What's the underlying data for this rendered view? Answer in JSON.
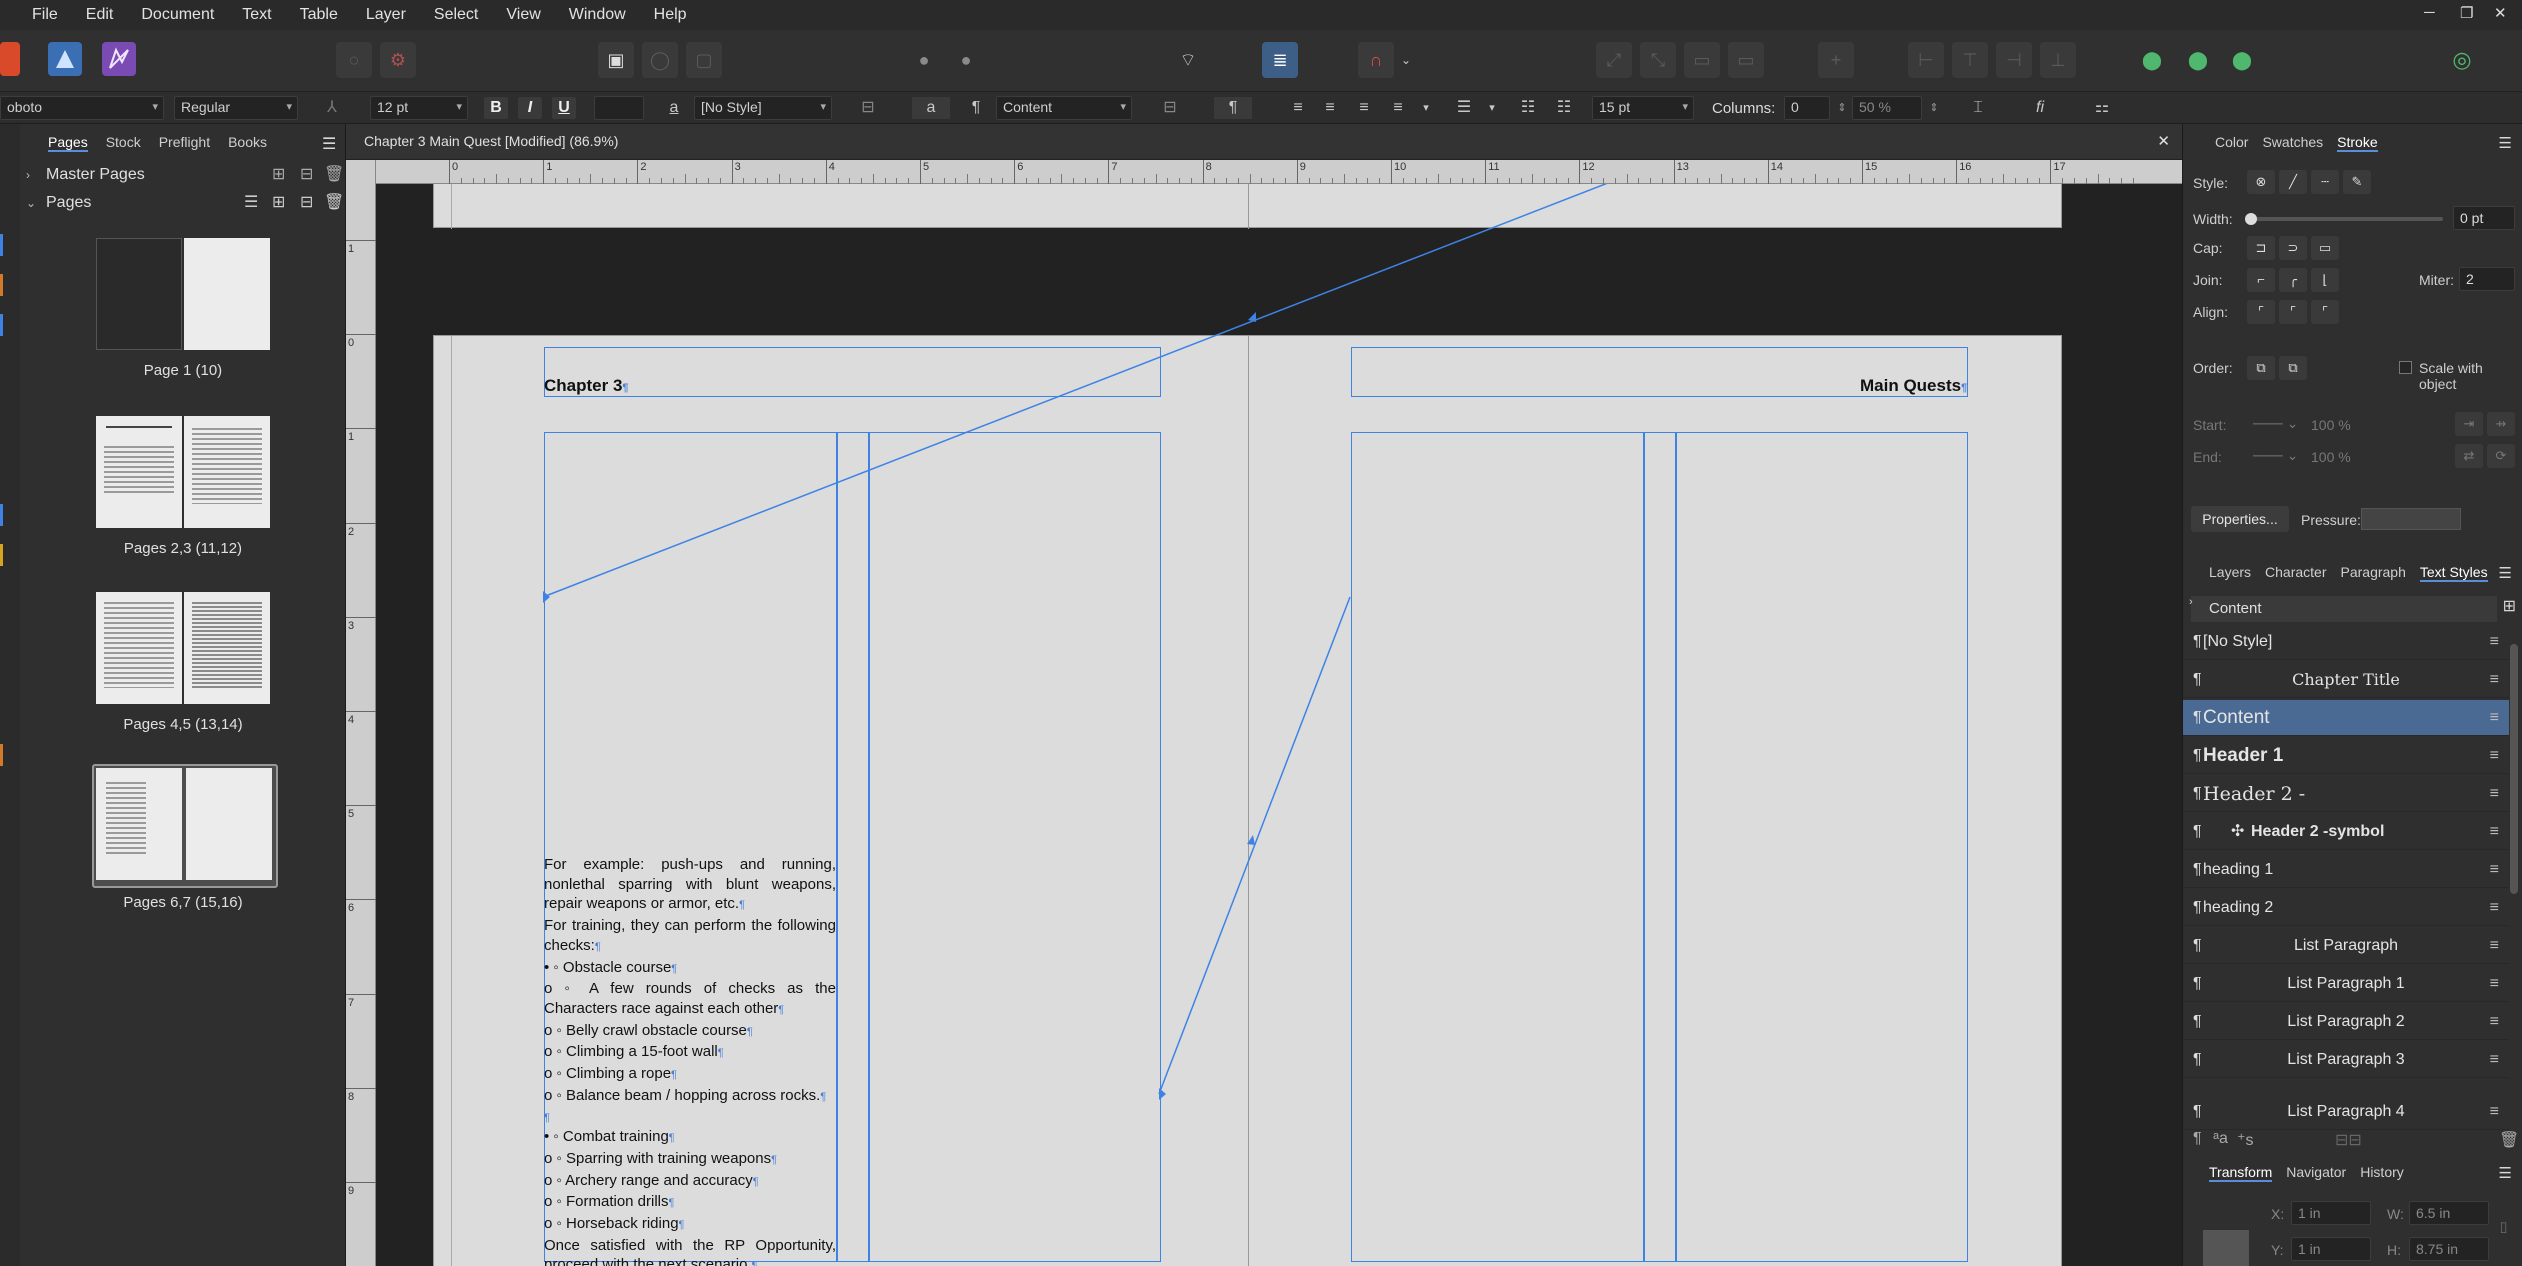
{
  "menu": [
    "File",
    "Edit",
    "Document",
    "Text",
    "Table",
    "Layer",
    "Select",
    "View",
    "Window",
    "Help"
  ],
  "context_bar": {
    "font_family": "oboto",
    "font_style": "Regular",
    "font_size": "12 pt",
    "bold": "B",
    "italic": "I",
    "underline": "U",
    "char_style": "[No Style]",
    "para_style": "Content",
    "leading": "15 pt",
    "columns_label": "Columns:",
    "columns_value": "0",
    "zoom_value": "50 %"
  },
  "pages_panel": {
    "tabs": [
      "Pages",
      "Stock",
      "Preflight",
      "Books"
    ],
    "master_pages": "Master Pages",
    "pages": "Pages",
    "thumbs": [
      "Page 1 (10)",
      "Pages 2,3 (11,12)",
      "Pages 4,5 (13,14)",
      "Pages 6,7 (15,16)"
    ]
  },
  "document": {
    "title": "Chapter 3 Main Quest [Modified] (86.9%)",
    "ruler_numbers": [
      "0",
      "1",
      "2",
      "3",
      "4",
      "5",
      "6",
      "7",
      "8",
      "9",
      "10",
      "11",
      "12",
      "13",
      "14",
      "15",
      "16",
      "17"
    ],
    "vruler_numbers": [
      "1",
      "0",
      "1",
      "2",
      "3",
      "4",
      "5",
      "6",
      "7",
      "8",
      "9"
    ],
    "header_left": "Chapter 3",
    "header_right": "Main Quests",
    "body": [
      "For example: push-ups and running, nonlethal sparring with blunt weapons, repair weapons or armor, etc.",
      "For training, they can perform the following checks:",
      "•   ◦   Obstacle course",
      "o   ◦   A few rounds of checks as the Characters race against each other",
      "o   ◦   Belly crawl obstacle course",
      "o   ◦   Climbing a 15-foot wall",
      "o   ◦   Climbing a rope",
      "o   ◦   Balance beam / hopping across rocks.",
      "",
      "•   ◦   Combat training",
      "o   ◦   Sparring with training weapons",
      "o   ◦   Archery range and accuracy",
      "o   ◦   Formation drills",
      "o   ◦   Horseback riding",
      "Once satisfied with the RP Opportunity, proceed with the next scenario."
    ]
  },
  "right_panel": {
    "top_tabs": [
      "Color",
      "Swatches",
      "Stroke"
    ],
    "style_label": "Style:",
    "width_label": "Width:",
    "width_value": "0 pt",
    "cap_label": "Cap:",
    "join_label": "Join:",
    "miter_label": "Miter:",
    "miter_value": "2",
    "align_label": "Align:",
    "order_label": "Order:",
    "scale_label": "Scale with object",
    "start_label": "Start:",
    "end_label": "End:",
    "start_pct": "100 %",
    "end_pct": "100 %",
    "properties_button": "Properties...",
    "pressure_label": "Pressure:",
    "mid_tabs": [
      "Layers",
      "Character",
      "Paragraph",
      "Text Styles"
    ],
    "current_style": "Content",
    "styles": [
      "[No Style]",
      "Chapter Title",
      "Content",
      "Header 1",
      "Header 2 -",
      "Header 2 -symbol",
      "heading 1",
      "heading 2",
      "List Paragraph",
      "List Paragraph 1",
      "List Paragraph 2",
      "List Paragraph 3",
      "List Paragraph 4"
    ],
    "bottom_tabs": [
      "Transform",
      "Navigator",
      "History"
    ],
    "transform": {
      "x_label": "X:",
      "x": "1 in",
      "y_label": "Y:",
      "y": "1 in",
      "w_label": "W:",
      "w": "6.5 in",
      "h_label": "H:",
      "h": "8.75 in"
    }
  },
  "colors": {
    "accent": "#3e83e4",
    "selection": "#4a6a94",
    "page": "#dcdcdc"
  }
}
